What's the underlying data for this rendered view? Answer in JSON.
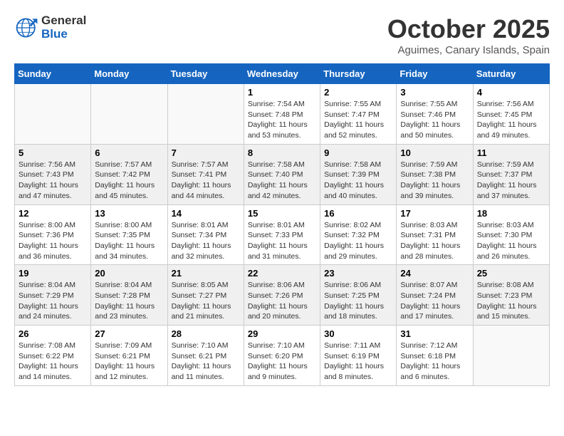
{
  "header": {
    "logo_general": "General",
    "logo_blue": "Blue",
    "month": "October 2025",
    "location": "Aguimes, Canary Islands, Spain"
  },
  "days_of_week": [
    "Sunday",
    "Monday",
    "Tuesday",
    "Wednesday",
    "Thursday",
    "Friday",
    "Saturday"
  ],
  "weeks": [
    [
      {
        "day": "",
        "info": ""
      },
      {
        "day": "",
        "info": ""
      },
      {
        "day": "",
        "info": ""
      },
      {
        "day": "1",
        "info": "Sunrise: 7:54 AM\nSunset: 7:48 PM\nDaylight: 11 hours\nand 53 minutes."
      },
      {
        "day": "2",
        "info": "Sunrise: 7:55 AM\nSunset: 7:47 PM\nDaylight: 11 hours\nand 52 minutes."
      },
      {
        "day": "3",
        "info": "Sunrise: 7:55 AM\nSunset: 7:46 PM\nDaylight: 11 hours\nand 50 minutes."
      },
      {
        "day": "4",
        "info": "Sunrise: 7:56 AM\nSunset: 7:45 PM\nDaylight: 11 hours\nand 49 minutes."
      }
    ],
    [
      {
        "day": "5",
        "info": "Sunrise: 7:56 AM\nSunset: 7:43 PM\nDaylight: 11 hours\nand 47 minutes."
      },
      {
        "day": "6",
        "info": "Sunrise: 7:57 AM\nSunset: 7:42 PM\nDaylight: 11 hours\nand 45 minutes."
      },
      {
        "day": "7",
        "info": "Sunrise: 7:57 AM\nSunset: 7:41 PM\nDaylight: 11 hours\nand 44 minutes."
      },
      {
        "day": "8",
        "info": "Sunrise: 7:58 AM\nSunset: 7:40 PM\nDaylight: 11 hours\nand 42 minutes."
      },
      {
        "day": "9",
        "info": "Sunrise: 7:58 AM\nSunset: 7:39 PM\nDaylight: 11 hours\nand 40 minutes."
      },
      {
        "day": "10",
        "info": "Sunrise: 7:59 AM\nSunset: 7:38 PM\nDaylight: 11 hours\nand 39 minutes."
      },
      {
        "day": "11",
        "info": "Sunrise: 7:59 AM\nSunset: 7:37 PM\nDaylight: 11 hours\nand 37 minutes."
      }
    ],
    [
      {
        "day": "12",
        "info": "Sunrise: 8:00 AM\nSunset: 7:36 PM\nDaylight: 11 hours\nand 36 minutes."
      },
      {
        "day": "13",
        "info": "Sunrise: 8:00 AM\nSunset: 7:35 PM\nDaylight: 11 hours\nand 34 minutes."
      },
      {
        "day": "14",
        "info": "Sunrise: 8:01 AM\nSunset: 7:34 PM\nDaylight: 11 hours\nand 32 minutes."
      },
      {
        "day": "15",
        "info": "Sunrise: 8:01 AM\nSunset: 7:33 PM\nDaylight: 11 hours\nand 31 minutes."
      },
      {
        "day": "16",
        "info": "Sunrise: 8:02 AM\nSunset: 7:32 PM\nDaylight: 11 hours\nand 29 minutes."
      },
      {
        "day": "17",
        "info": "Sunrise: 8:03 AM\nSunset: 7:31 PM\nDaylight: 11 hours\nand 28 minutes."
      },
      {
        "day": "18",
        "info": "Sunrise: 8:03 AM\nSunset: 7:30 PM\nDaylight: 11 hours\nand 26 minutes."
      }
    ],
    [
      {
        "day": "19",
        "info": "Sunrise: 8:04 AM\nSunset: 7:29 PM\nDaylight: 11 hours\nand 24 minutes."
      },
      {
        "day": "20",
        "info": "Sunrise: 8:04 AM\nSunset: 7:28 PM\nDaylight: 11 hours\nand 23 minutes."
      },
      {
        "day": "21",
        "info": "Sunrise: 8:05 AM\nSunset: 7:27 PM\nDaylight: 11 hours\nand 21 minutes."
      },
      {
        "day": "22",
        "info": "Sunrise: 8:06 AM\nSunset: 7:26 PM\nDaylight: 11 hours\nand 20 minutes."
      },
      {
        "day": "23",
        "info": "Sunrise: 8:06 AM\nSunset: 7:25 PM\nDaylight: 11 hours\nand 18 minutes."
      },
      {
        "day": "24",
        "info": "Sunrise: 8:07 AM\nSunset: 7:24 PM\nDaylight: 11 hours\nand 17 minutes."
      },
      {
        "day": "25",
        "info": "Sunrise: 8:08 AM\nSunset: 7:23 PM\nDaylight: 11 hours\nand 15 minutes."
      }
    ],
    [
      {
        "day": "26",
        "info": "Sunrise: 7:08 AM\nSunset: 6:22 PM\nDaylight: 11 hours\nand 14 minutes."
      },
      {
        "day": "27",
        "info": "Sunrise: 7:09 AM\nSunset: 6:21 PM\nDaylight: 11 hours\nand 12 minutes."
      },
      {
        "day": "28",
        "info": "Sunrise: 7:10 AM\nSunset: 6:21 PM\nDaylight: 11 hours\nand 11 minutes."
      },
      {
        "day": "29",
        "info": "Sunrise: 7:10 AM\nSunset: 6:20 PM\nDaylight: 11 hours\nand 9 minutes."
      },
      {
        "day": "30",
        "info": "Sunrise: 7:11 AM\nSunset: 6:19 PM\nDaylight: 11 hours\nand 8 minutes."
      },
      {
        "day": "31",
        "info": "Sunrise: 7:12 AM\nSunset: 6:18 PM\nDaylight: 11 hours\nand 6 minutes."
      },
      {
        "day": "",
        "info": ""
      }
    ]
  ]
}
